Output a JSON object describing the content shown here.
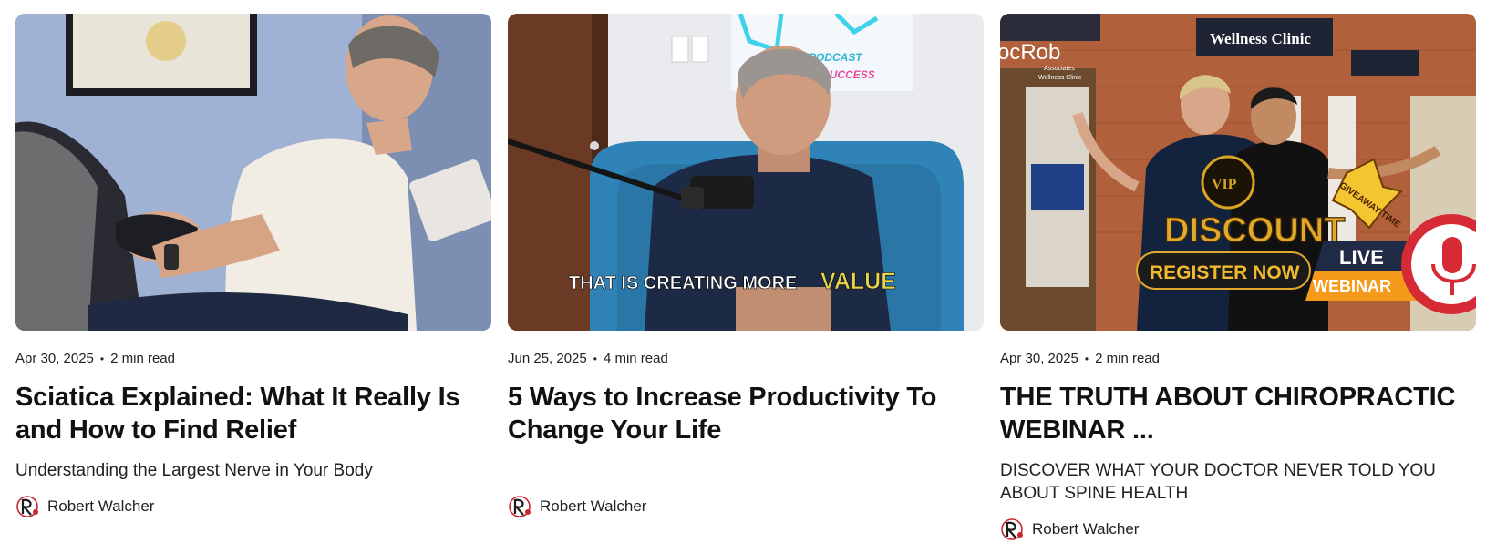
{
  "posts": [
    {
      "date": "Apr 30, 2025",
      "separator": "•",
      "read_time": "2 min read",
      "title": "Sciatica Explained: What It Really Is and How to Find Relief",
      "subtitle": "Understanding the Largest Nerve in Your Body",
      "author": "Robert Walcher"
    },
    {
      "date": "Jun 25, 2025",
      "separator": "•",
      "read_time": "4 min read",
      "title": "5 Ways to Increase Productivity To Change Your Life",
      "subtitle": "",
      "author": "Robert Walcher",
      "thumb_caption_a": "THAT IS CREATING MORE",
      "thumb_caption_b": "VALUE",
      "thumb_sign_a": "PODCAST",
      "thumb_sign_b": "TO SUCCESS"
    },
    {
      "date": "Apr 30, 2025",
      "separator": "•",
      "read_time": "2 min read",
      "title": "THE TRUTH ABOUT CHIROPRACTIC WEBINAR ...",
      "subtitle": "DISCOVER WHAT YOUR DOCTOR NEVER TOLD YOU ABOUT SPINE HEALTH",
      "author": "Robert Walcher",
      "thumb_sign": "Wellness Clinic",
      "thumb_doc": "ocRob",
      "thumb_doc_sub": "Associates",
      "thumb_doc_sub2": "Wellness Clinic",
      "thumb_vip": "VIP",
      "thumb_giveaway": "GIVEAWAY TIME",
      "thumb_discount": "DISCOUNT",
      "thumb_register": "REGISTER NOW",
      "thumb_live": "LIVE",
      "thumb_webinar": "WEBINAR"
    }
  ],
  "colors": {
    "text": "#111111",
    "accent_yellow": "#e8d34a",
    "webinar_orange": "#f59a1b",
    "mic_red": "#d62b35",
    "gold": "#d9a521"
  }
}
